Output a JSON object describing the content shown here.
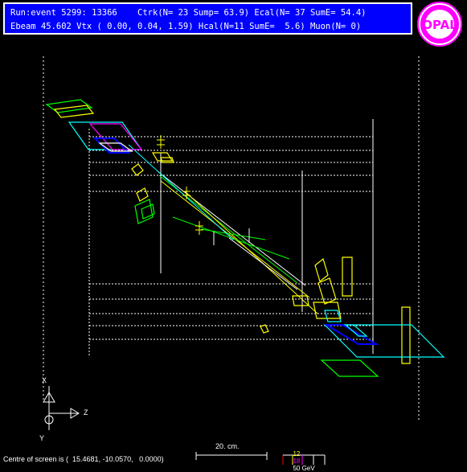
{
  "header": {
    "line1": "Run:event 5299: 13366    Ctrk(N= 23 Sump= 63.9) Ecal(N= 37 SumE= 54.4)",
    "line2": "Ebeam 45.602 Vtx ( 0.00, 0.04, 1.59) Hcal(N=11 SumE=  5.6) Muon(N= 0)"
  },
  "logo": {
    "text": "OPAL",
    "ring_color": "#ff00ff"
  },
  "axes": {
    "x_label": "X",
    "y_label": "Y",
    "z_label": "Z"
  },
  "scale": {
    "length_label": "20. cm."
  },
  "energy_scale": {
    "labels": [
      "12",
      "18",
      "50 GeV"
    ],
    "colors": [
      "#ffff00",
      "#ff00ff",
      "#ffffff"
    ]
  },
  "footer": {
    "centre_text": "Centre of screen is (  15.4681, -10.0570,   0.0000)"
  },
  "colors": {
    "background": "#000000",
    "panel": "#0000ff",
    "ecal": "#ffff00",
    "hcal": "#00ff00",
    "muon": "#ff00ff",
    "blocks": "#00ffff",
    "tracks": "#00ff00",
    "detector": "#ffffff"
  }
}
